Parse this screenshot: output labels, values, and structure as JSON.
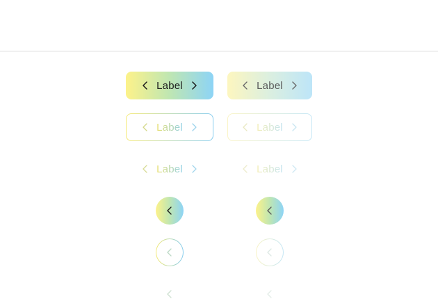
{
  "buttons": {
    "label": "Label"
  },
  "colors": {
    "gradient_start": "#fdf28a",
    "gradient_end": "#8dd4f6",
    "divider": "#dcdcdc"
  },
  "icons": {
    "prev": "chevron-left-icon",
    "next": "chevron-right-icon"
  }
}
